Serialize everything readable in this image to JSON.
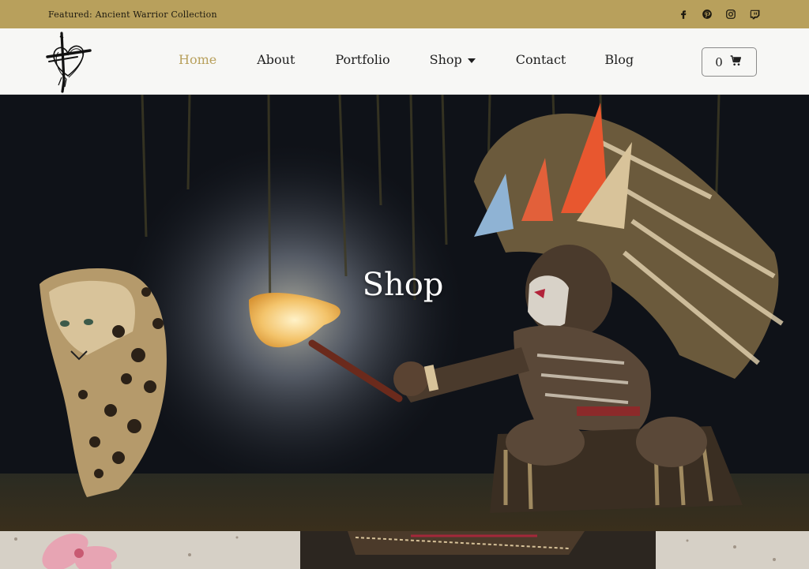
{
  "topbar": {
    "featured": "Featured: Ancient Warrior Collection",
    "social": [
      "facebook-icon",
      "pinterest-icon",
      "instagram-icon",
      "twitch-icon"
    ]
  },
  "nav": {
    "items": [
      {
        "label": "Home",
        "active": true
      },
      {
        "label": "About"
      },
      {
        "label": "Portfolio"
      },
      {
        "label": "Shop",
        "has_dropdown": true
      },
      {
        "label": "Contact"
      },
      {
        "label": "Blog"
      }
    ]
  },
  "cart": {
    "count": "0",
    "icon": "cart-icon"
  },
  "hero": {
    "title": "Shop"
  },
  "colors": {
    "accent": "#b8a05c",
    "topbar": "#b8a05c",
    "header_bg": "#f7f7f5",
    "text": "#1e1e1e"
  }
}
